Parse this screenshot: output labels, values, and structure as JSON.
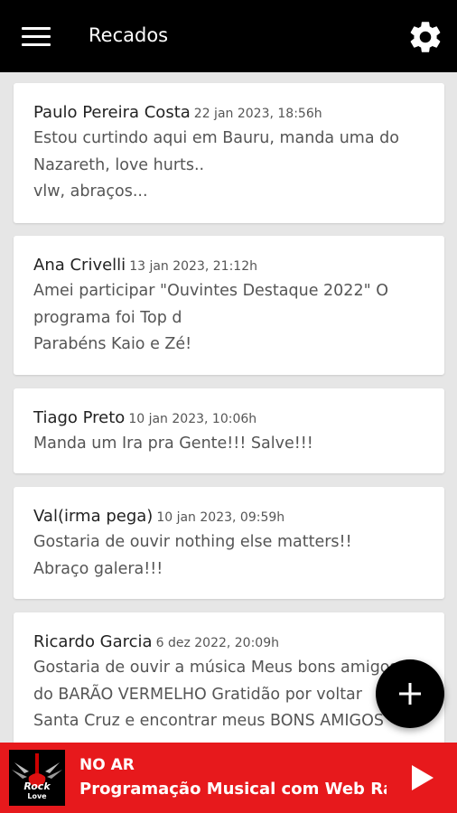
{
  "header": {
    "title": "Recados",
    "menu_icon": "menu-icon",
    "settings_icon": "gear-icon"
  },
  "messages": [
    {
      "author": "Paulo Pereira Costa",
      "date": "22 jan 2023, 18:56h",
      "text": "Estou curtindo aqui em Bauru, manda uma do\nNazareth, love hurts..\nvlw, abraços..."
    },
    {
      "author": "Ana Crivelli",
      "date": "13 jan 2023, 21:12h",
      "text": "Amei participar \"Ouvintes Destaque 2022\" O\nprograma foi Top d\nParabéns Kaio e Zé!"
    },
    {
      "author": "Tiago Preto",
      "date": "10 jan 2023, 10:06h",
      "text": "Manda um Ira pra Gente!!! Salve!!!"
    },
    {
      "author": "Val(irma pega)",
      "date": "10 jan 2023, 09:59h",
      "text": "Gostaria de ouvir nothing else matters!!\nAbraço galera!!!"
    },
    {
      "author": "Ricardo Garcia",
      "date": "6 dez 2022, 20:09h",
      "text": "Gostaria de ouvir a música Meus bons amigos\ndo BARÃO VERMELHO Gratidão por voltar\nSanta Cruz e encontrar meus BONS AMIGOS"
    }
  ],
  "fab": {
    "icon": "plus-icon"
  },
  "player": {
    "status": "NO AR",
    "program": "Programação Musical com Web Rád..",
    "logo_text": "Rock Love",
    "play_icon": "play-icon",
    "color": "#e7191c"
  }
}
